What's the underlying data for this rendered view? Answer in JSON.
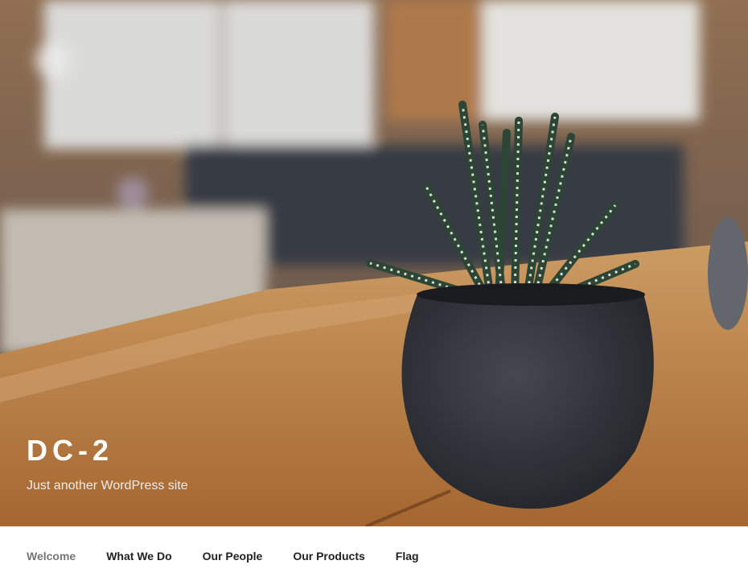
{
  "site": {
    "title": "DC-2",
    "description": "Just another WordPress site"
  },
  "nav": {
    "items": [
      {
        "label": "Welcome",
        "current": true
      },
      {
        "label": "What We Do",
        "current": false
      },
      {
        "label": "Our People",
        "current": false
      },
      {
        "label": "Our Products",
        "current": false
      },
      {
        "label": "Flag",
        "current": false
      }
    ]
  },
  "colors": {
    "nav_text": "#222222",
    "nav_current": "#767676",
    "title": "#ffffff"
  }
}
